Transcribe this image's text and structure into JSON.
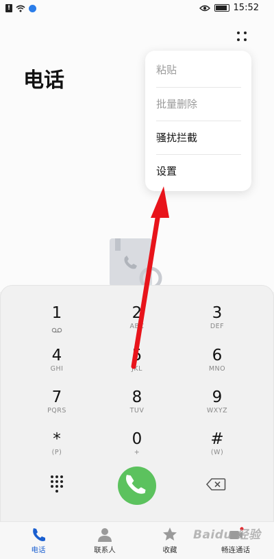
{
  "status_bar": {
    "time": "15:52"
  },
  "header": {
    "title": "电话"
  },
  "menu": {
    "items": [
      {
        "label": "粘贴",
        "enabled": false
      },
      {
        "label": "批量删除",
        "enabled": false
      },
      {
        "label": "骚扰拦截",
        "enabled": true
      },
      {
        "label": "设置",
        "enabled": true
      }
    ]
  },
  "dialpad": {
    "keys": [
      {
        "digit": "1",
        "letters": "voicemail"
      },
      {
        "digit": "2",
        "letters": "ABC"
      },
      {
        "digit": "3",
        "letters": "DEF"
      },
      {
        "digit": "4",
        "letters": "GHI"
      },
      {
        "digit": "5",
        "letters": "JKL"
      },
      {
        "digit": "6",
        "letters": "MNO"
      },
      {
        "digit": "7",
        "letters": "PQRS"
      },
      {
        "digit": "8",
        "letters": "TUV"
      },
      {
        "digit": "9",
        "letters": "WXYZ"
      },
      {
        "digit": "*",
        "letters": "(P)"
      },
      {
        "digit": "0",
        "letters": "+"
      },
      {
        "digit": "#",
        "letters": "(W)"
      }
    ]
  },
  "bottom_nav": {
    "items": [
      {
        "label": "电话",
        "icon": "phone-icon",
        "active": true
      },
      {
        "label": "联系人",
        "icon": "person-icon",
        "active": false
      },
      {
        "label": "收藏",
        "icon": "star-icon",
        "active": false
      },
      {
        "label": "畅连通话",
        "icon": "video-call-icon",
        "active": false
      }
    ]
  },
  "watermark": "Baidu 经验",
  "colors": {
    "accent": "#1a5fd0",
    "call": "#5cc25e",
    "annotation_arrow": "#e8141b"
  }
}
